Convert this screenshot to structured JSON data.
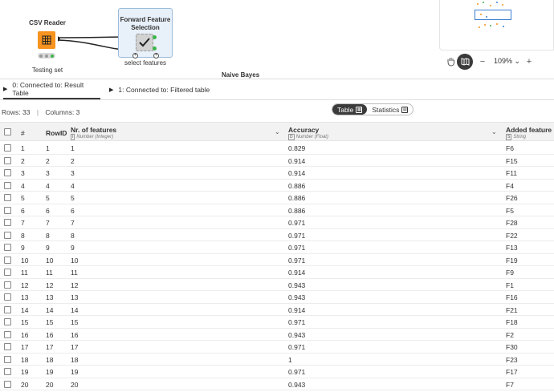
{
  "workflow": {
    "csv_reader": {
      "title": "CSV Reader",
      "caption": "Testing set"
    },
    "ffs": {
      "title_line1": "Forward Feature",
      "title_line2": "Selection",
      "caption": "select features"
    },
    "naive_bayes_label": "Naive Bayes"
  },
  "zoom": {
    "level": "109%"
  },
  "tabs": [
    {
      "label": "0: Connected to: Result Table",
      "active": true
    },
    {
      "label": "1: Connected to: Filtered table",
      "active": false
    }
  ],
  "info": {
    "rows": "Rows: 33",
    "sep": "|",
    "columns": "Columns: 3"
  },
  "view_toggle": {
    "table": "Table",
    "statistics": "Statistics"
  },
  "columns": [
    {
      "name": "#",
      "type": ""
    },
    {
      "name": "RowID",
      "type": ""
    },
    {
      "name": "Nr. of features",
      "type_icon": "I",
      "type": "Number (Integer)"
    },
    {
      "name": "Accuracy",
      "type_icon": "D",
      "type": "Number (Float)"
    },
    {
      "name": "Added feature",
      "type_icon": "S",
      "type": "String"
    }
  ],
  "rows": [
    [
      "1",
      "1",
      "1",
      "0.829",
      "F6"
    ],
    [
      "2",
      "2",
      "2",
      "0.914",
      "F15"
    ],
    [
      "3",
      "3",
      "3",
      "0.914",
      "F11"
    ],
    [
      "4",
      "4",
      "4",
      "0.886",
      "F4"
    ],
    [
      "5",
      "5",
      "5",
      "0.886",
      "F26"
    ],
    [
      "6",
      "6",
      "6",
      "0.886",
      "F5"
    ],
    [
      "7",
      "7",
      "7",
      "0.971",
      "F28"
    ],
    [
      "8",
      "8",
      "8",
      "0.971",
      "F22"
    ],
    [
      "9",
      "9",
      "9",
      "0.971",
      "F13"
    ],
    [
      "10",
      "10",
      "10",
      "0.971",
      "F19"
    ],
    [
      "11",
      "11",
      "11",
      "0.914",
      "F9"
    ],
    [
      "12",
      "12",
      "12",
      "0.943",
      "F1"
    ],
    [
      "13",
      "13",
      "13",
      "0.943",
      "F16"
    ],
    [
      "14",
      "14",
      "14",
      "0.914",
      "F21"
    ],
    [
      "15",
      "15",
      "15",
      "0.971",
      "F18"
    ],
    [
      "16",
      "16",
      "16",
      "0.943",
      "F2"
    ],
    [
      "17",
      "17",
      "17",
      "0.971",
      "F30"
    ],
    [
      "18",
      "18",
      "18",
      "1",
      "F23"
    ],
    [
      "19",
      "19",
      "19",
      "0.971",
      "F17"
    ],
    [
      "20",
      "20",
      "20",
      "0.943",
      "F7"
    ]
  ],
  "colors": {
    "node_orange": "#f7931e",
    "selection_blue": "#9bbbdb",
    "active_dark": "#3a3a3a"
  }
}
